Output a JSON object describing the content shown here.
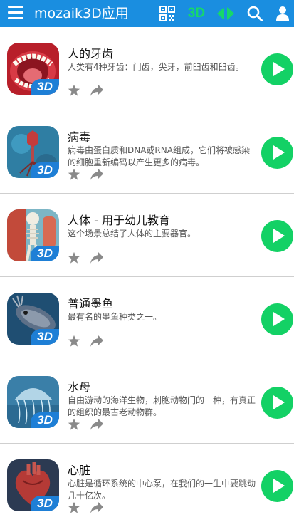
{
  "appbar": {
    "title": "mozaik3D应用",
    "mode_label": "3D",
    "icons": {
      "menu": "menu-icon",
      "qr": "qr-code-icon",
      "mode": "3d-icon",
      "arrows": "arrows-icon",
      "search": "search-icon",
      "user": "user-icon"
    },
    "color": "#1a8ee0",
    "accent": "#16d86a"
  },
  "items": [
    {
      "name": "人的牙齿",
      "desc": "人类有4种牙齿：门齿，尖牙，前臼齿和臼齿。",
      "badge": "3D"
    },
    {
      "name": "病毒",
      "desc": "病毒由蛋白质和DNA或RNA组成，它们将被感染的细胞重新编码以产生更多的病毒。",
      "badge": "3D"
    },
    {
      "name": "人体 - 用于幼儿教育",
      "desc": "这个场景总结了人体的主要器官。",
      "badge": "3D"
    },
    {
      "name": "普通墨鱼",
      "desc": "最有名的墨鱼种类之一。",
      "badge": "3D"
    },
    {
      "name": "水母",
      "desc": "自由游动的海洋生物，刺胞动物门的一种，有真正的组织的最古老动物群。",
      "badge": "3D"
    },
    {
      "name": "心脏",
      "desc": "心脏是循环系统的中心泵，在我们的一生中要跳动几十亿次。",
      "badge": "3D"
    }
  ],
  "colors": {
    "play": "#13d165",
    "badge": "#1e7fd6"
  }
}
